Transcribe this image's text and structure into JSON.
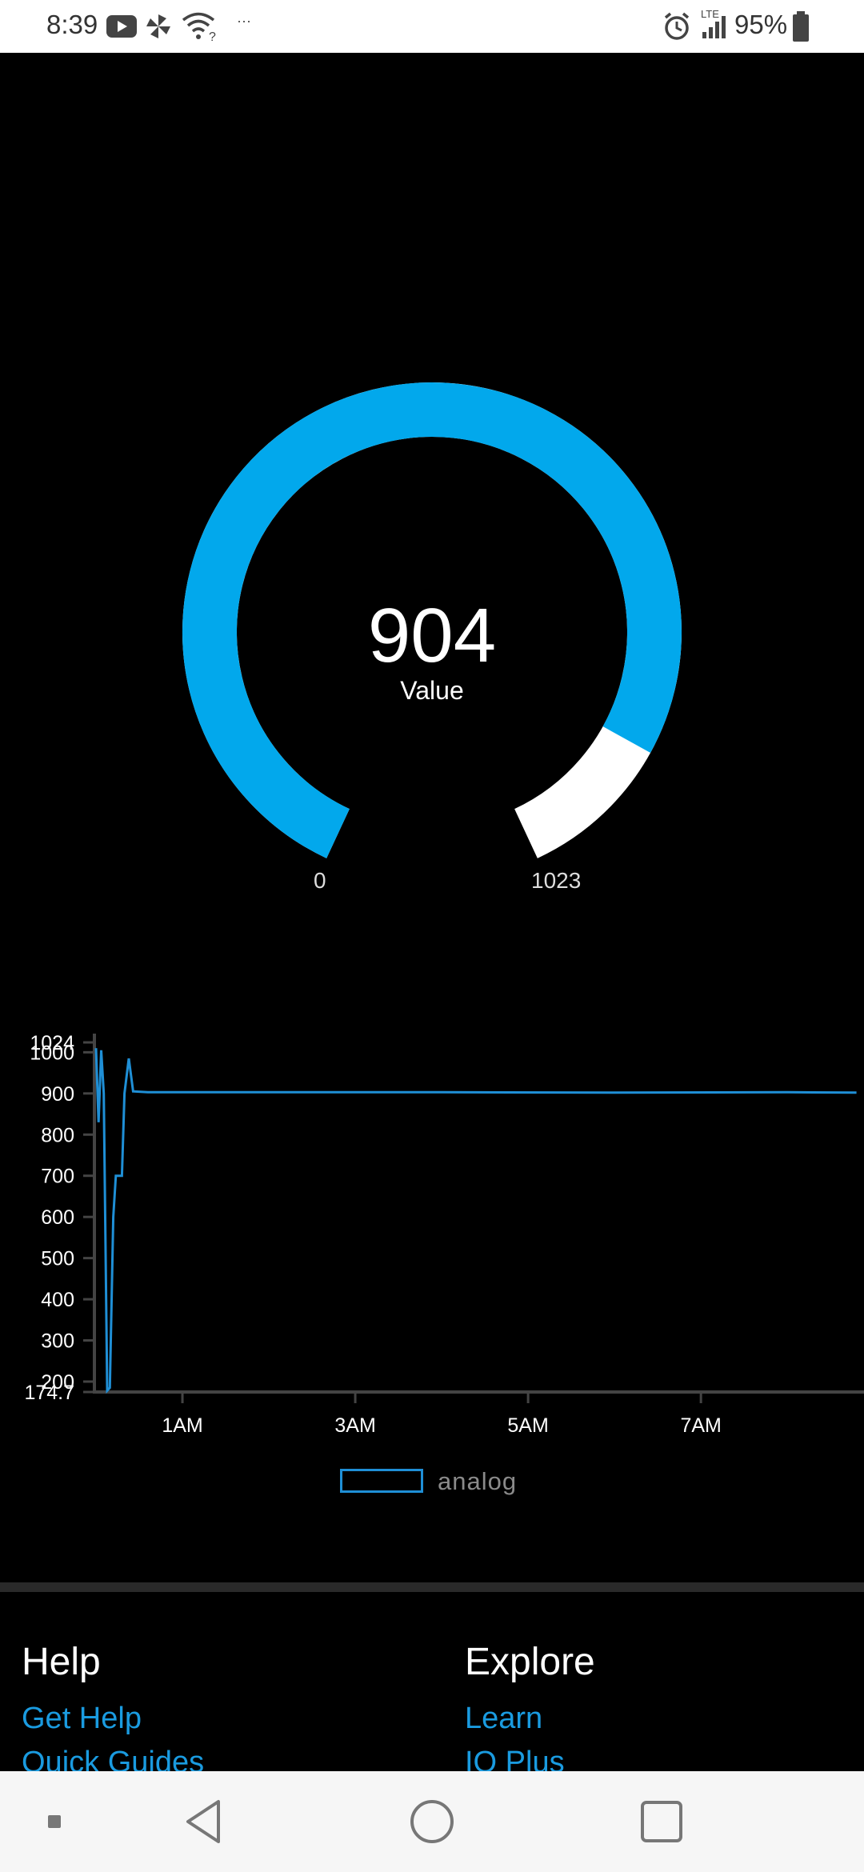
{
  "status_bar": {
    "time": "8:39",
    "more_glyph": "···",
    "lte_label": "LTE",
    "battery_percent": "95%",
    "icons": [
      "youtube-icon",
      "pinwheel-icon",
      "wifi-question-icon",
      "alarm-icon",
      "signal-icon",
      "battery-icon"
    ]
  },
  "gauge": {
    "value": "904",
    "label": "Value",
    "min_label": "0",
    "max_label": "1023",
    "current": 904,
    "min": 0,
    "max": 1023,
    "fill_color": "#02a8ec",
    "track_color": "#ffffff"
  },
  "chart_data": {
    "type": "line",
    "series": [
      {
        "name": "analog",
        "color": "#1f8fd6",
        "points": [
          [
            0.0,
            1010
          ],
          [
            0.03,
            830
          ],
          [
            0.06,
            1005
          ],
          [
            0.09,
            900
          ],
          [
            0.13,
            178
          ],
          [
            0.16,
            185
          ],
          [
            0.2,
            600
          ],
          [
            0.23,
            700
          ],
          [
            0.3,
            700
          ],
          [
            0.33,
            900
          ],
          [
            0.38,
            985
          ],
          [
            0.43,
            905
          ],
          [
            0.6,
            903
          ],
          [
            2.0,
            903
          ],
          [
            4.0,
            903
          ],
          [
            6.0,
            902
          ],
          [
            8.0,
            903
          ],
          [
            8.8,
            902
          ]
        ]
      }
    ],
    "x_ticks": [
      "1AM",
      "3AM",
      "5AM",
      "7AM"
    ],
    "x_tick_values": [
      1,
      3,
      5,
      7
    ],
    "y_ticks": [
      "1024",
      "1000",
      "900",
      "800",
      "700",
      "600",
      "500",
      "400",
      "300",
      "200",
      "174.7"
    ],
    "y_tick_values": [
      1024,
      1000,
      900,
      800,
      700,
      600,
      500,
      400,
      300,
      200,
      174.7
    ],
    "xlim": [
      0,
      8.85
    ],
    "ylim": [
      174.7,
      1024
    ],
    "legend": "bottom-center",
    "grid": false
  },
  "footer": {
    "help_heading": "Help",
    "help_links": [
      "Get Help",
      "Quick Guides"
    ],
    "explore_heading": "Explore",
    "explore_links": [
      "Learn",
      "IO Plus"
    ]
  },
  "nav_bar": {
    "buttons": [
      "recent-square-icon",
      "back-icon",
      "home-icon",
      "overview-icon"
    ]
  }
}
